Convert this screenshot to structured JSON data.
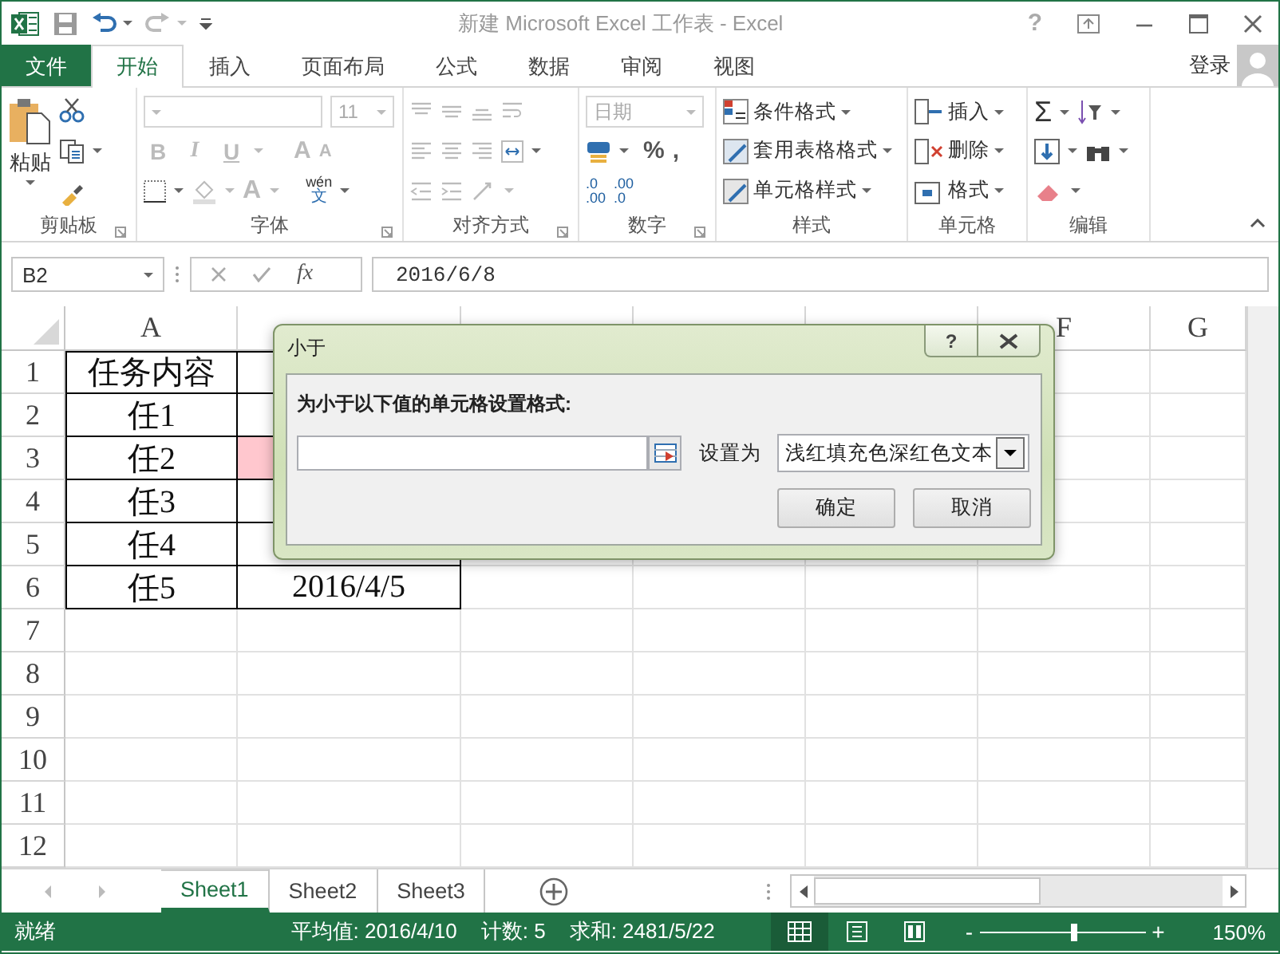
{
  "title_bar": {
    "title": "新建 Microsoft Excel 工作表 - Excel",
    "help": "?"
  },
  "tabs": [
    {
      "label": "文件",
      "kind": "file",
      "selected": false
    },
    {
      "label": "开始",
      "kind": "tab",
      "selected": true
    },
    {
      "label": "插入",
      "kind": "tab",
      "selected": false
    },
    {
      "label": "页面布局",
      "kind": "tab",
      "selected": false
    },
    {
      "label": "公式",
      "kind": "tab",
      "selected": false
    },
    {
      "label": "数据",
      "kind": "tab",
      "selected": false
    },
    {
      "label": "审阅",
      "kind": "tab",
      "selected": false
    },
    {
      "label": "视图",
      "kind": "tab",
      "selected": false
    }
  ],
  "account": {
    "label": "登录"
  },
  "ribbon": {
    "groups": [
      {
        "kind": "clipboard",
        "label": "剪贴板",
        "launcher": true,
        "paste": "粘贴"
      },
      {
        "kind": "font",
        "label": "字体",
        "launcher": true,
        "disabled": true,
        "font_size": "11",
        "buttons": [
          "B",
          "I",
          "U"
        ],
        "grow": "A",
        "shrink": "A",
        "font_color": "A",
        "phonetic_top": "wén",
        "phonetic_bottom": "文"
      },
      {
        "kind": "alignment",
        "label": "对齐方式",
        "launcher": true,
        "disabled": true
      },
      {
        "kind": "number",
        "label": "数字",
        "launcher": true,
        "format": "日期",
        "format_disabled": true,
        "percent": "%",
        "comma": ",",
        "decimals": [
          {
            "top": ".0",
            "bottom": ".00"
          },
          {
            "top": ".00",
            "bottom": ".0"
          }
        ]
      },
      {
        "kind": "styles",
        "label": "样式",
        "launcher": false,
        "items": [
          "条件格式",
          "套用表格格式",
          "单元格样式"
        ]
      },
      {
        "kind": "cells",
        "label": "单元格",
        "launcher": false,
        "items": [
          "插入",
          "删除",
          "格式"
        ]
      },
      {
        "kind": "editing",
        "label": "编辑",
        "launcher": false,
        "sum": "Σ"
      }
    ]
  },
  "formula_bar": {
    "name_box": "B2",
    "fx": "fx",
    "value": "2016/6/8"
  },
  "grid": {
    "columns": [
      {
        "label": "A"
      },
      {},
      {},
      {},
      {},
      {
        "label": "F"
      },
      {
        "label": "G"
      }
    ],
    "rows": [
      {
        "number": "1",
        "cells": [
          {
            "text": "任务内容",
            "bordered": true
          },
          {
            "bordered": true
          }
        ]
      },
      {
        "number": "2",
        "cells": [
          {
            "text": "任1",
            "bordered": true
          },
          {
            "bordered": true
          }
        ]
      },
      {
        "number": "3",
        "cells": [
          {
            "text": "任2",
            "bordered": true
          },
          {
            "bordered": true,
            "color": "#ffc7ce"
          }
        ]
      },
      {
        "number": "4",
        "cells": [
          {
            "text": "任3",
            "bordered": true
          },
          {
            "bordered": true
          }
        ]
      },
      {
        "number": "5",
        "cells": [
          {
            "text": "任4",
            "bordered": true
          },
          {
            "bordered": true
          }
        ]
      },
      {
        "number": "6",
        "cells": [
          {
            "text": "任5",
            "bordered": true
          },
          {
            "text": "2016/4/5",
            "bordered": true
          }
        ]
      },
      {
        "number": "7"
      },
      {
        "number": "8"
      },
      {
        "number": "9"
      },
      {
        "number": "10"
      },
      {
        "number": "11"
      },
      {
        "number": "12"
      }
    ]
  },
  "dialog": {
    "title": "小于",
    "help": "?",
    "prompt": "为小于以下值的单元格设置格式:",
    "format_label": "设置为",
    "format_value": "浅红填充色深红色文本",
    "buttons": [
      "确定",
      "取消"
    ]
  },
  "sheets": [
    {
      "label": "Sheet1",
      "selected": true
    },
    {
      "label": "Sheet2",
      "selected": false
    },
    {
      "label": "Sheet3",
      "selected": false
    }
  ],
  "status": {
    "ready": "就绪",
    "average": "平均值: 2016/4/10",
    "count": "计数: 5",
    "sum": "求和: 2481/5/22",
    "views": [
      {
        "kind": "normal",
        "selected": true
      },
      {
        "kind": "page_layout",
        "selected": false
      },
      {
        "kind": "page_break",
        "selected": false
      }
    ],
    "zoom_out": "-",
    "zoom_in": "+",
    "zoom": {
      "level": 0.57
    },
    "zoom_label": "150%"
  }
}
